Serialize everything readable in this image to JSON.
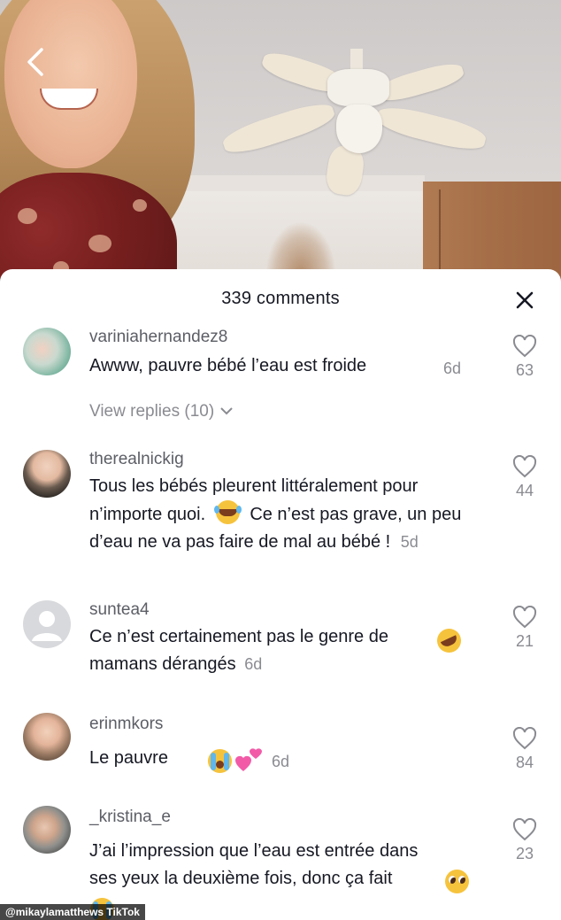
{
  "header": {
    "comment_count_label": "339 comments"
  },
  "icons": {
    "back": "chevron-left-icon",
    "close": "close-icon",
    "like": "heart-outline-icon"
  },
  "comments": [
    {
      "username": "variniahernandez8",
      "text": "Awww, pauvre bébé l’eau est froide",
      "date": "6d",
      "likes": "63",
      "replies_label": "View replies (10)"
    },
    {
      "username": "therealnickig",
      "text_parts": [
        "Tous les bébés pleurent littéralement pour n’importe quoi.",
        "Ce n’est pas grave, un peu d’eau ne va pas faire de mal au bébé !"
      ],
      "date": "5d",
      "likes": "44",
      "emojis": [
        "face-with-tears-of-joy"
      ]
    },
    {
      "username": "suntea4",
      "text": "Ce n’est certainement pas le genre de mamans dérangés",
      "date": "6d",
      "likes": "21",
      "emojis": [
        "rolling-on-the-floor-laughing"
      ]
    },
    {
      "username": "erinmkors",
      "text": "Le pauvre",
      "date": "6d",
      "likes": "84",
      "emojis": [
        "loudly-crying-face",
        "two-hearts"
      ]
    },
    {
      "username": "_kristina_e",
      "text": "J’ai l’impression que l’eau est entrée dans ses yeux la deuxième fois, donc ça fait",
      "likes": "23",
      "emojis": [
        "pleading-face",
        "loudly-crying-face"
      ]
    }
  ],
  "watermark": "@mikaylamatthews TikTok",
  "colors": {
    "sheet_background": "#ffffff",
    "primary_text": "#161823",
    "secondary_text": "#8a8b91"
  }
}
